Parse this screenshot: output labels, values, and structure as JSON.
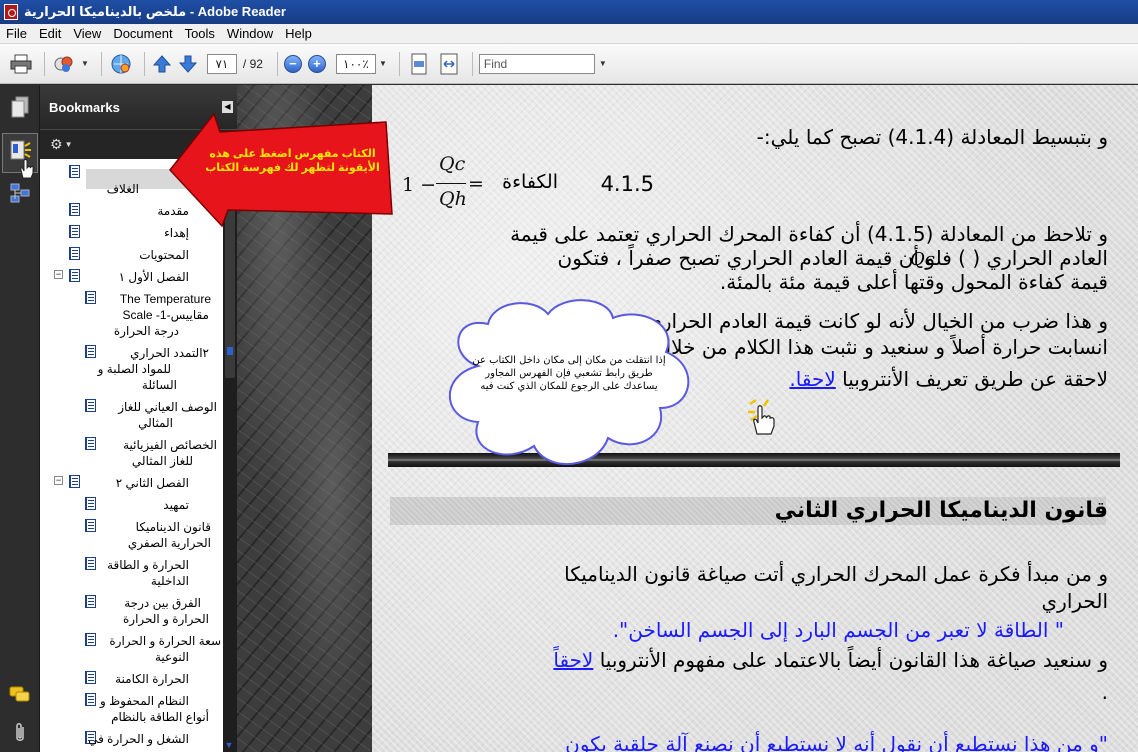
{
  "window": {
    "title": "ملخص بالديناميكا الحرارية - Adobe Reader"
  },
  "menu": [
    "File",
    "Edit",
    "View",
    "Document",
    "Tools",
    "Window",
    "Help"
  ],
  "toolbar": {
    "page_current": "٧١",
    "page_total": "/ 92",
    "zoom": "١٠٠٪",
    "zoom_out": "−",
    "zoom_in": "+",
    "find_placeholder": "Find"
  },
  "bookmarks": {
    "title": "Bookmarks",
    "items": [
      {
        "label": "الغلاف"
      },
      {
        "label": "مقدمة"
      },
      {
        "label": "إهداء"
      },
      {
        "label": "المحتويات"
      },
      {
        "label": "الفصل الأول ١"
      },
      {
        "label": "The Temperature"
      },
      {
        "label": "مقاييس-1- Scale"
      },
      {
        "label": "درجة الحرارة"
      },
      {
        "label": "٢التمدد الحراري"
      },
      {
        "label": "للمواد الصلبة و"
      },
      {
        "label": "السائلة"
      },
      {
        "label": "الوصف العياني للغاز"
      },
      {
        "label": "المثالي"
      },
      {
        "label": "الخصائص الفيزيائية"
      },
      {
        "label": "للغاز المثالي"
      },
      {
        "label": "الفصل الثاني ٢"
      },
      {
        "label": "تمهيد"
      },
      {
        "label": "قانون الديناميكا"
      },
      {
        "label": "الحرارية الصفري"
      },
      {
        "label": "الحرارة و الطاقة"
      },
      {
        "label": "الداخلية"
      },
      {
        "label": "الفرق بين درجة"
      },
      {
        "label": "الحرارة و الحرارة"
      },
      {
        "label": "سعة الحرارة و الحرارة"
      },
      {
        "label": "النوعية"
      },
      {
        "label": "الحرارة الكامنة"
      },
      {
        "label": "النظام المحفوظ و"
      },
      {
        "label": "أنواع الطاقة بالنظام"
      },
      {
        "label": "الشغل و الحرارة في"
      }
    ]
  },
  "document": {
    "line1": "و بتبسيط المعادلة (4.1.4) تصبح كما يلي:-",
    "eq_label": "الكفاءة",
    "eq_num": "4.1.5",
    "eq_one": "1 −",
    "eq_qc": "Qc",
    "eq_qh": "Qh",
    "eq_equals": "=",
    "para1": [
      "و تلاحظ من المعادلة (4.1.5) أن كفاءة المحرك الحراري تعتمد على قيمة",
      "العادم الحراري (       ) فلو أن قيمة العادم الحراري تصبح صفراً ، فتكون",
      "قيمة كفاءة المحول وقتها أعلى قيمة مئة بالمئة.",
      "و هذا ضرب من الخيال لأنه لو كانت قيمة العادم الحراري صفراً لما",
      "انسابت حرارة أصلاً و سنعيد و نثبت هذا الكلام من خلال الوصول",
      "لاحقة عن طريق تعريف الأنتروبيا"
    ],
    "para1_inline_qc": "Qc",
    "link_later": "لاحقا.",
    "heading": "قانون الديناميكا الحراري الثاني",
    "para2": [
      "و من مبدأ فكرة عمل المحرك الحراري أتت صياغة قانون الديناميكا",
      "الحراري"
    ],
    "quote": "\" الطاقة لا تعبر من الجسم البارد إلى الجسم الساخن\".",
    "para3": "و سنعيد صياغة هذا القانون أيضاً بالاعتماد على مفهوم الأنتروبيا",
    "link_later2": "لاحقاً",
    "dot": ".",
    "cut_line": "\"و من هذا نستطيع أن نقول أنه لا نستطيع أن نصنع آلة حلقية يكون"
  },
  "annotations": {
    "red_callout": "الكتاب مفهرس اضغط على هذه الأيقونة لتظهر لك فهرسة الكتاب",
    "cloud": "إذا انتقلت من مكان إلى مكان داخل الكتاب عن طريق رابط تشعبي فإن الفهرس المجاور يساعدك على الرجوع للمكان الذي كنت فيه"
  },
  "colors": {
    "title_bar": "#1f4fa6",
    "link_blue": "#1a1aff",
    "callout_red": "#e8141b",
    "callout_text": "#ffe800"
  }
}
